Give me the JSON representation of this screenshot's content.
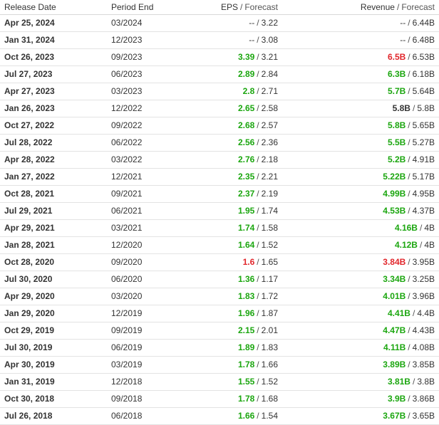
{
  "headers": {
    "release": "Release Date",
    "period": "Period End",
    "eps": "EPS",
    "eps_forecast": "Forecast",
    "revenue": "Revenue",
    "revenue_forecast": "Forecast",
    "sep": "/"
  },
  "colors": {
    "beat": "#1ba60f",
    "miss": "#e1262b",
    "neutral": "#333333"
  },
  "rows": [
    {
      "release": "Apr 25, 2024",
      "period": "03/2024",
      "eps": "--",
      "eps_fc": "3.22",
      "eps_s": "none",
      "rev": "--",
      "rev_fc": "6.44B",
      "rev_s": "none"
    },
    {
      "release": "Jan 31, 2024",
      "period": "12/2023",
      "eps": "--",
      "eps_fc": "3.08",
      "eps_s": "none",
      "rev": "--",
      "rev_fc": "6.48B",
      "rev_s": "none"
    },
    {
      "release": "Oct 26, 2023",
      "period": "09/2023",
      "eps": "3.39",
      "eps_fc": "3.21",
      "eps_s": "beat",
      "rev": "6.5B",
      "rev_fc": "6.53B",
      "rev_s": "miss"
    },
    {
      "release": "Jul 27, 2023",
      "period": "06/2023",
      "eps": "2.89",
      "eps_fc": "2.84",
      "eps_s": "beat",
      "rev": "6.3B",
      "rev_fc": "6.18B",
      "rev_s": "beat"
    },
    {
      "release": "Apr 27, 2023",
      "period": "03/2023",
      "eps": "2.8",
      "eps_fc": "2.71",
      "eps_s": "beat",
      "rev": "5.7B",
      "rev_fc": "5.64B",
      "rev_s": "beat"
    },
    {
      "release": "Jan 26, 2023",
      "period": "12/2022",
      "eps": "2.65",
      "eps_fc": "2.58",
      "eps_s": "beat",
      "rev": "5.8B",
      "rev_fc": "5.8B",
      "rev_s": "neutral"
    },
    {
      "release": "Oct 27, 2022",
      "period": "09/2022",
      "eps": "2.68",
      "eps_fc": "2.57",
      "eps_s": "beat",
      "rev": "5.8B",
      "rev_fc": "5.65B",
      "rev_s": "beat"
    },
    {
      "release": "Jul 28, 2022",
      "period": "06/2022",
      "eps": "2.56",
      "eps_fc": "2.36",
      "eps_s": "beat",
      "rev": "5.5B",
      "rev_fc": "5.27B",
      "rev_s": "beat"
    },
    {
      "release": "Apr 28, 2022",
      "period": "03/2022",
      "eps": "2.76",
      "eps_fc": "2.18",
      "eps_s": "beat",
      "rev": "5.2B",
      "rev_fc": "4.91B",
      "rev_s": "beat"
    },
    {
      "release": "Jan 27, 2022",
      "period": "12/2021",
      "eps": "2.35",
      "eps_fc": "2.21",
      "eps_s": "beat",
      "rev": "5.22B",
      "rev_fc": "5.17B",
      "rev_s": "beat"
    },
    {
      "release": "Oct 28, 2021",
      "period": "09/2021",
      "eps": "2.37",
      "eps_fc": "2.19",
      "eps_s": "beat",
      "rev": "4.99B",
      "rev_fc": "4.95B",
      "rev_s": "beat"
    },
    {
      "release": "Jul 29, 2021",
      "period": "06/2021",
      "eps": "1.95",
      "eps_fc": "1.74",
      "eps_s": "beat",
      "rev": "4.53B",
      "rev_fc": "4.37B",
      "rev_s": "beat"
    },
    {
      "release": "Apr 29, 2021",
      "period": "03/2021",
      "eps": "1.74",
      "eps_fc": "1.58",
      "eps_s": "beat",
      "rev": "4.16B",
      "rev_fc": "4B",
      "rev_s": "beat"
    },
    {
      "release": "Jan 28, 2021",
      "period": "12/2020",
      "eps": "1.64",
      "eps_fc": "1.52",
      "eps_s": "beat",
      "rev": "4.12B",
      "rev_fc": "4B",
      "rev_s": "beat"
    },
    {
      "release": "Oct 28, 2020",
      "period": "09/2020",
      "eps": "1.6",
      "eps_fc": "1.65",
      "eps_s": "miss",
      "rev": "3.84B",
      "rev_fc": "3.95B",
      "rev_s": "miss"
    },
    {
      "release": "Jul 30, 2020",
      "period": "06/2020",
      "eps": "1.36",
      "eps_fc": "1.17",
      "eps_s": "beat",
      "rev": "3.34B",
      "rev_fc": "3.25B",
      "rev_s": "beat"
    },
    {
      "release": "Apr 29, 2020",
      "period": "03/2020",
      "eps": "1.83",
      "eps_fc": "1.72",
      "eps_s": "beat",
      "rev": "4.01B",
      "rev_fc": "3.96B",
      "rev_s": "beat"
    },
    {
      "release": "Jan 29, 2020",
      "period": "12/2019",
      "eps": "1.96",
      "eps_fc": "1.87",
      "eps_s": "beat",
      "rev": "4.41B",
      "rev_fc": "4.4B",
      "rev_s": "beat"
    },
    {
      "release": "Oct 29, 2019",
      "period": "09/2019",
      "eps": "2.15",
      "eps_fc": "2.01",
      "eps_s": "beat",
      "rev": "4.47B",
      "rev_fc": "4.43B",
      "rev_s": "beat"
    },
    {
      "release": "Jul 30, 2019",
      "period": "06/2019",
      "eps": "1.89",
      "eps_fc": "1.83",
      "eps_s": "beat",
      "rev": "4.11B",
      "rev_fc": "4.08B",
      "rev_s": "beat"
    },
    {
      "release": "Apr 30, 2019",
      "period": "03/2019",
      "eps": "1.78",
      "eps_fc": "1.66",
      "eps_s": "beat",
      "rev": "3.89B",
      "rev_fc": "3.85B",
      "rev_s": "beat"
    },
    {
      "release": "Jan 31, 2019",
      "period": "12/2018",
      "eps": "1.55",
      "eps_fc": "1.52",
      "eps_s": "beat",
      "rev": "3.81B",
      "rev_fc": "3.8B",
      "rev_s": "beat"
    },
    {
      "release": "Oct 30, 2018",
      "period": "09/2018",
      "eps": "1.78",
      "eps_fc": "1.68",
      "eps_s": "beat",
      "rev": "3.9B",
      "rev_fc": "3.86B",
      "rev_s": "beat"
    },
    {
      "release": "Jul 26, 2018",
      "period": "06/2018",
      "eps": "1.66",
      "eps_fc": "1.54",
      "eps_s": "beat",
      "rev": "3.67B",
      "rev_fc": "3.65B",
      "rev_s": "beat"
    }
  ]
}
